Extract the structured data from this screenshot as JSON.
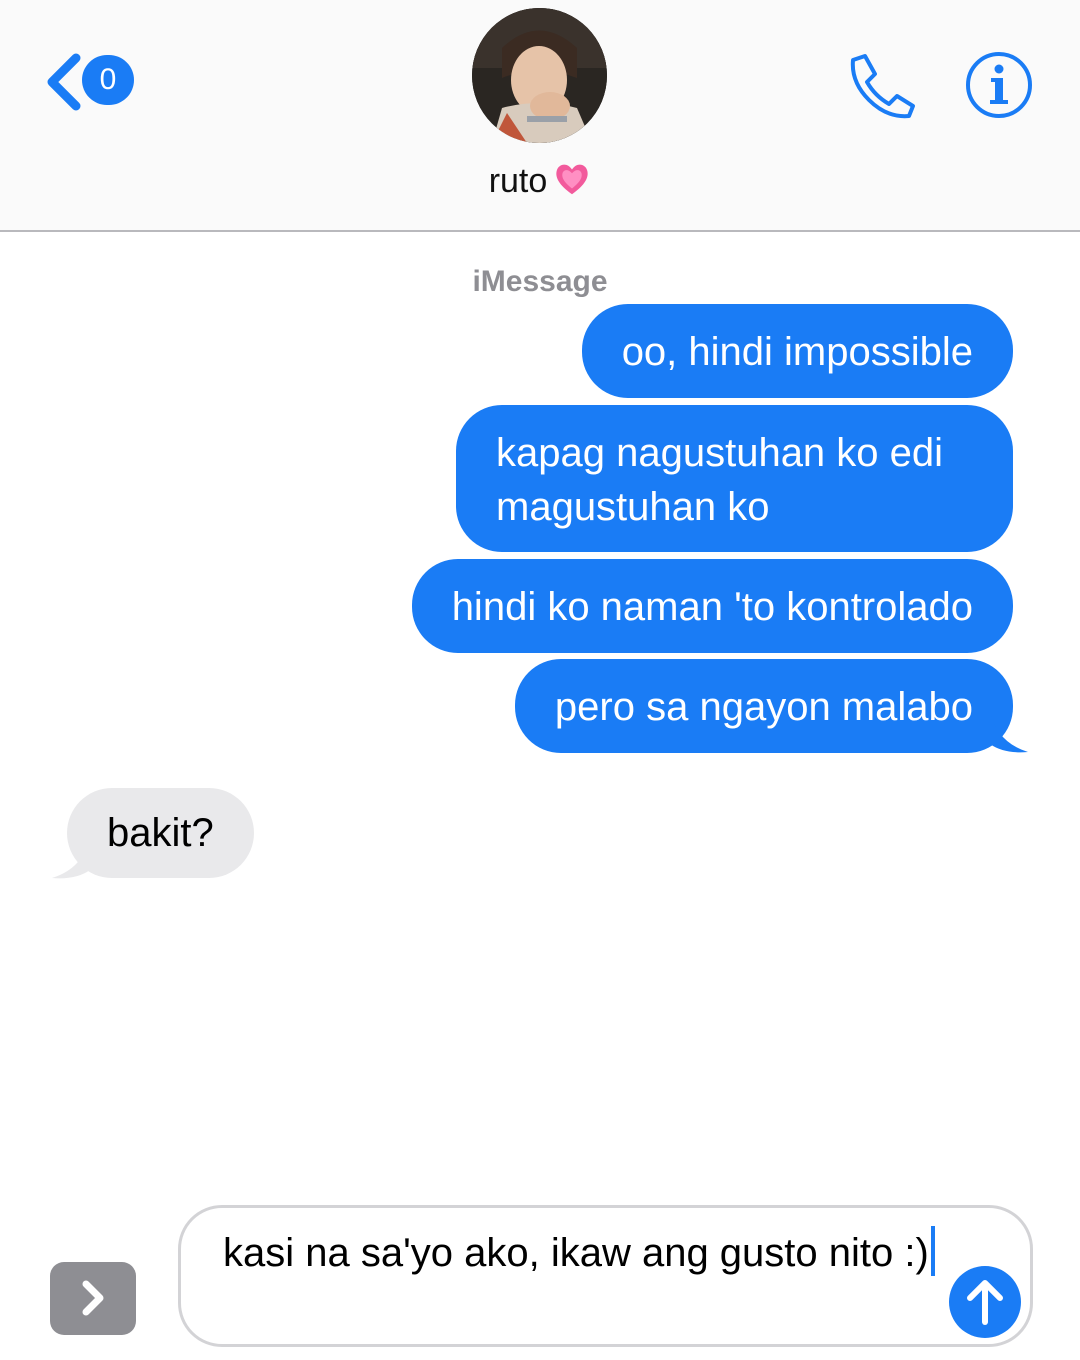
{
  "header": {
    "unread_count": "0",
    "contact_name": "ruto",
    "contact_emoji": "💗"
  },
  "thread": {
    "service_label": "iMessage",
    "messages": [
      {
        "direction": "outgoing",
        "text": "oo, hindi impossible"
      },
      {
        "direction": "outgoing",
        "text": "kapag nagustuhan ko edi magustuhan ko"
      },
      {
        "direction": "outgoing",
        "text": "hindi ko naman 'to kontrolado"
      },
      {
        "direction": "outgoing",
        "text": "pero sa ngayon malabo"
      },
      {
        "direction": "incoming",
        "text": "bakit?"
      }
    ]
  },
  "composer": {
    "draft_text": "kasi na sa'yo ako, ikaw ang gusto nito :)"
  },
  "colors": {
    "accent": "#1a7cf5",
    "incoming_bubble": "#e9e9eb",
    "secondary_text": "#8e8e93"
  }
}
